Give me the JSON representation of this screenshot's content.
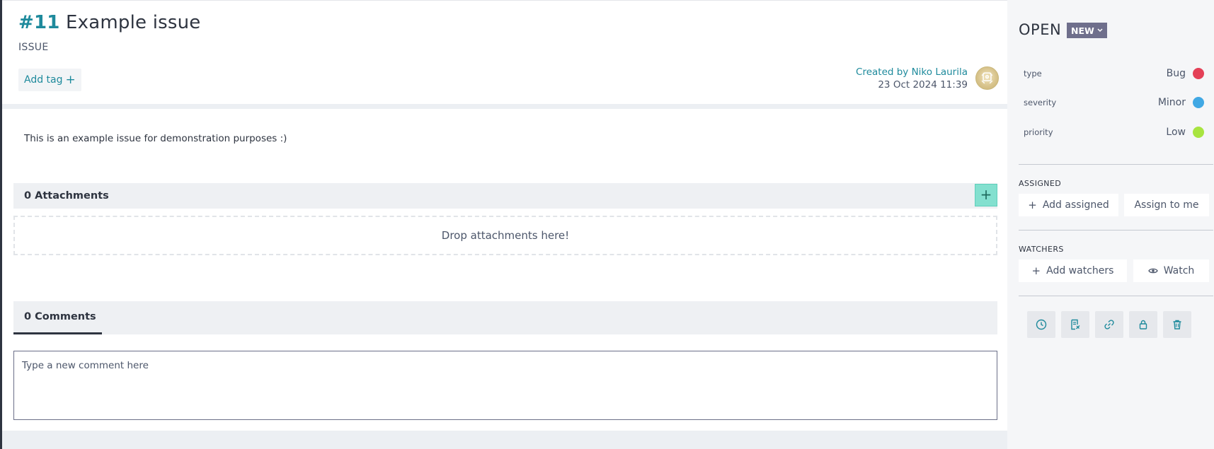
{
  "issue": {
    "ref": "#11",
    "title": "Example issue",
    "kind": "ISSUE",
    "add_tag_label": "Add tag",
    "created_by": "Created by Niko Laurila",
    "created_date": "23 Oct 2024 11:39",
    "description": "This is an example issue for demonstration purposes :)"
  },
  "attachments": {
    "title": "0 Attachments",
    "add_label": "+",
    "dropzone_text": "Drop attachments here!"
  },
  "comments": {
    "tab_label": "0 Comments",
    "placeholder": "Type a new comment here"
  },
  "sidebar": {
    "status": "OPEN",
    "status_badge": "NEW",
    "attributes": [
      {
        "key": "type",
        "value": "Bug",
        "color": "#e44057"
      },
      {
        "key": "severity",
        "value": "Minor",
        "color": "#40a8e4"
      },
      {
        "key": "priority",
        "value": "Low",
        "color": "#a8e440"
      }
    ],
    "assigned": {
      "label": "ASSIGNED",
      "add_label": "Add assigned",
      "assign_me_label": "Assign to me"
    },
    "watchers": {
      "label": "WATCHERS",
      "add_label": "Add watchers",
      "watch_label": "Watch"
    },
    "actions": [
      "clock-icon",
      "edit-document-icon",
      "link-icon",
      "lock-icon",
      "trash-icon"
    ]
  },
  "colors": {
    "accent": "#1e8a9c",
    "add_button": "#83e0cf",
    "status_badge": "#6f6f8c"
  }
}
